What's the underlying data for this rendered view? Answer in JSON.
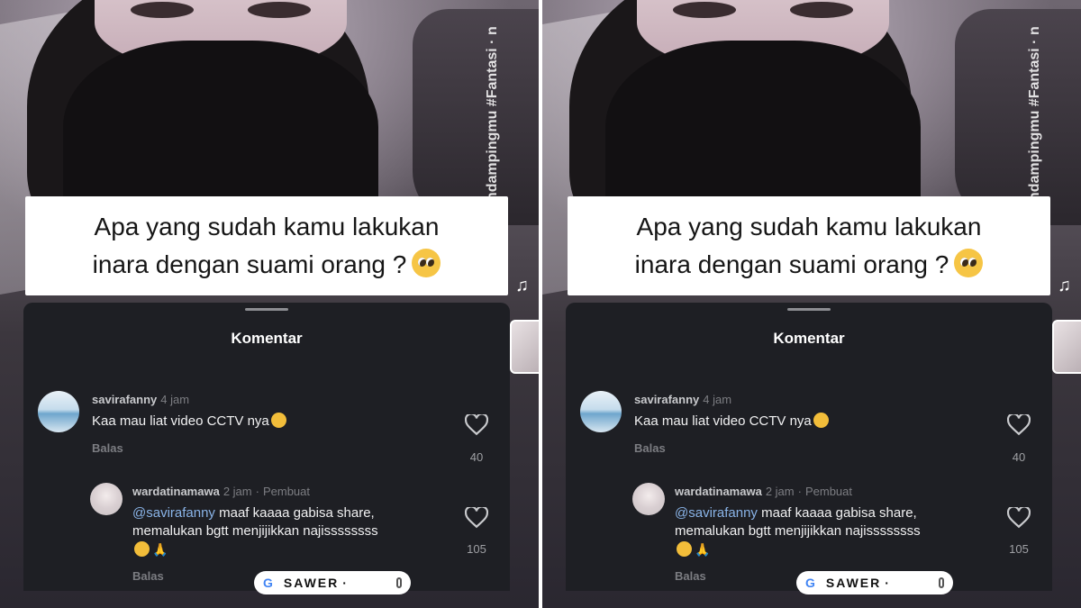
{
  "video": {
    "side_text": "namawa · Pendampingmu #Fantasi · nor",
    "caption": {
      "line1": "Apa yang sudah kamu lakukan",
      "line2": "inara dengan suami orang ?",
      "emoji": "pleading-face-emoji"
    }
  },
  "comments_sheet": {
    "title": "Komentar",
    "comments": [
      {
        "username": "savirafanny",
        "time": "4 jam",
        "text": "Kaa mau liat video CCTV nya",
        "reply_label": "Balas",
        "likes": "40"
      },
      {
        "username": "wardatinamawa",
        "time": "2 jam",
        "tag": "Pembuat",
        "mention": "@savirafanny",
        "text_line1": " maaf kaaaa gabisa share,",
        "text_line2": "memalukan bgtt menjijikkan najissssssss",
        "reply_label": "Balas",
        "likes": "105"
      }
    ]
  },
  "overlay": {
    "brand": "SAWER",
    "g_letter": "G"
  }
}
